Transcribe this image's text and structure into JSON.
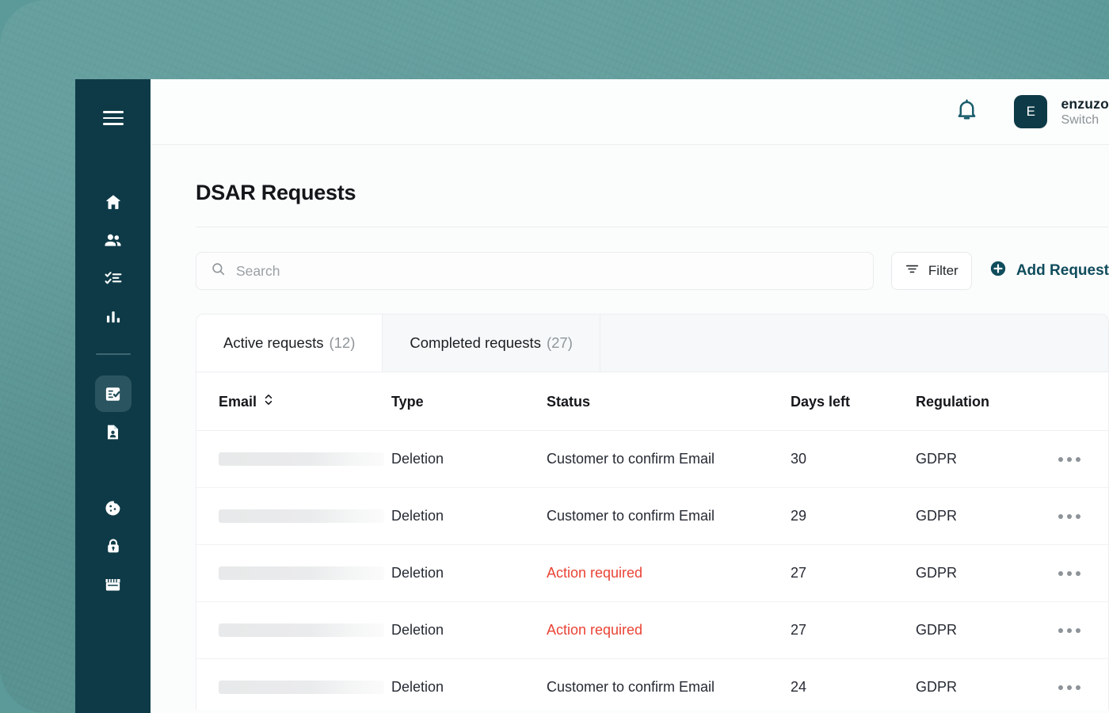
{
  "app": {
    "account_name": "enzuzo",
    "account_sub": "Switch",
    "avatar_initial": "E",
    "notifications_icon": "bell-icon",
    "accent_color": "#0f4c5c",
    "alert_color": "#ea4335",
    "sidebar_color": "#0e3a47",
    "backdrop_color": "#5c9a99"
  },
  "sidebar": {
    "menu_toggle": "hamburger-icon",
    "items": [
      {
        "icon": "home-icon",
        "name": "home",
        "active": false
      },
      {
        "icon": "people-icon",
        "name": "customers",
        "active": false
      },
      {
        "icon": "checklist-icon",
        "name": "tasks",
        "active": false
      },
      {
        "icon": "bar-chart-icon",
        "name": "analytics",
        "active": false
      },
      {
        "icon": "document-check-icon",
        "name": "dsar",
        "active": true
      },
      {
        "icon": "document-person-icon",
        "name": "records",
        "active": false
      },
      {
        "icon": "cookie-icon",
        "name": "cookies",
        "active": false
      },
      {
        "icon": "lock-icon",
        "name": "security",
        "active": false
      },
      {
        "icon": "storefront-icon",
        "name": "store",
        "active": false
      }
    ]
  },
  "page": {
    "title": "DSAR Requests"
  },
  "search": {
    "placeholder": "Search",
    "value": "",
    "icon": "search-icon"
  },
  "toolbar": {
    "filter_label": "Filter",
    "filter_icon": "filter-icon",
    "add_label": "Add Request",
    "add_icon": "plus-circle-icon"
  },
  "tabs": [
    {
      "label": "Active requests",
      "count": "(12)",
      "selected": true
    },
    {
      "label": "Completed requests",
      "count": "(27)",
      "selected": false
    }
  ],
  "table": {
    "columns": [
      {
        "key": "email",
        "label": "Email",
        "sortable": true
      },
      {
        "key": "type",
        "label": "Type",
        "sortable": false
      },
      {
        "key": "status",
        "label": "Status",
        "sortable": false
      },
      {
        "key": "days_left",
        "label": "Days left",
        "sortable": false
      },
      {
        "key": "regulation",
        "label": "Regulation",
        "sortable": false
      },
      {
        "key": "actions",
        "label": "",
        "sortable": false
      }
    ],
    "rows": [
      {
        "email": "",
        "type": "Deletion",
        "status": "Customer to confirm Email",
        "status_alert": false,
        "days_left": "30",
        "regulation": "GDPR",
        "actions_icon": "more-horizontal-icon"
      },
      {
        "email": "",
        "type": "Deletion",
        "status": "Customer to confirm Email",
        "status_alert": false,
        "days_left": "29",
        "regulation": "GDPR",
        "actions_icon": "more-horizontal-icon"
      },
      {
        "email": "",
        "type": "Deletion",
        "status": "Action required",
        "status_alert": true,
        "days_left": "27",
        "regulation": "GDPR",
        "actions_icon": "more-horizontal-icon"
      },
      {
        "email": "",
        "type": "Deletion",
        "status": "Action required",
        "status_alert": true,
        "days_left": "27",
        "regulation": "GDPR",
        "actions_icon": "more-horizontal-icon"
      },
      {
        "email": "",
        "type": "Deletion",
        "status": "Customer to confirm Email",
        "status_alert": false,
        "days_left": "24",
        "regulation": "GDPR",
        "actions_icon": "more-horizontal-icon"
      }
    ]
  }
}
